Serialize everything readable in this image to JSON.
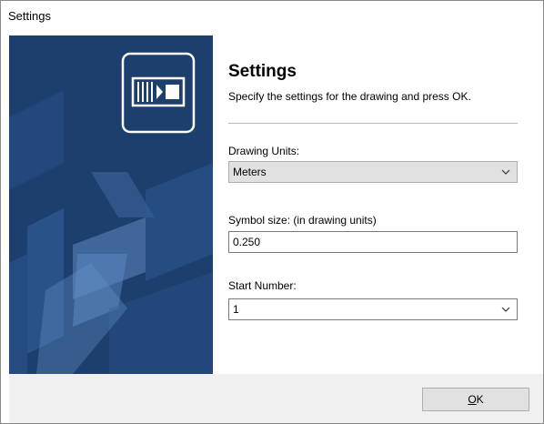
{
  "window": {
    "title": "Settings"
  },
  "banner": {
    "icon": "drawing-settings-icon",
    "background": "#1d3f6e"
  },
  "header": {
    "title": "Settings",
    "subtitle": "Specify the settings for the drawing and press OK."
  },
  "fields": {
    "units": {
      "label": "Drawing Units:",
      "value": "Meters"
    },
    "symbol_size": {
      "label": "Symbol size: (in drawing units)",
      "value": "0.250"
    },
    "start_number": {
      "label": "Start Number:",
      "value": "1"
    }
  },
  "footer": {
    "ok_mnemonic": "O",
    "ok_rest": "K"
  }
}
